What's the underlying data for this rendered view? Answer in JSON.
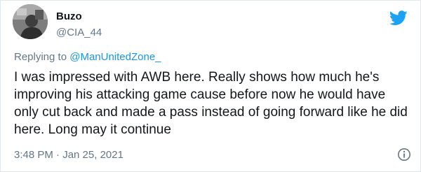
{
  "author": {
    "display_name": "Buzo",
    "handle": "@CIA_44",
    "avatar_icon": "avatar"
  },
  "reply": {
    "prefix": "Replying to ",
    "mention": "@ManUnitedZone_"
  },
  "tweet": {
    "text": "I was impressed with AWB here. Really shows how much he's improving his attacking game cause before now he would have only cut back and made a pass instead of going forward like he did here. Long may it continue",
    "timestamp": "3:48 PM · Jan 25, 2021"
  },
  "icons": {
    "brand": "twitter-bird-icon",
    "info": "info-icon"
  },
  "colors": {
    "brand_blue": "#1da1f2",
    "mention_blue": "#1b95e0",
    "secondary_text": "#657786",
    "primary_text": "#14171a"
  }
}
